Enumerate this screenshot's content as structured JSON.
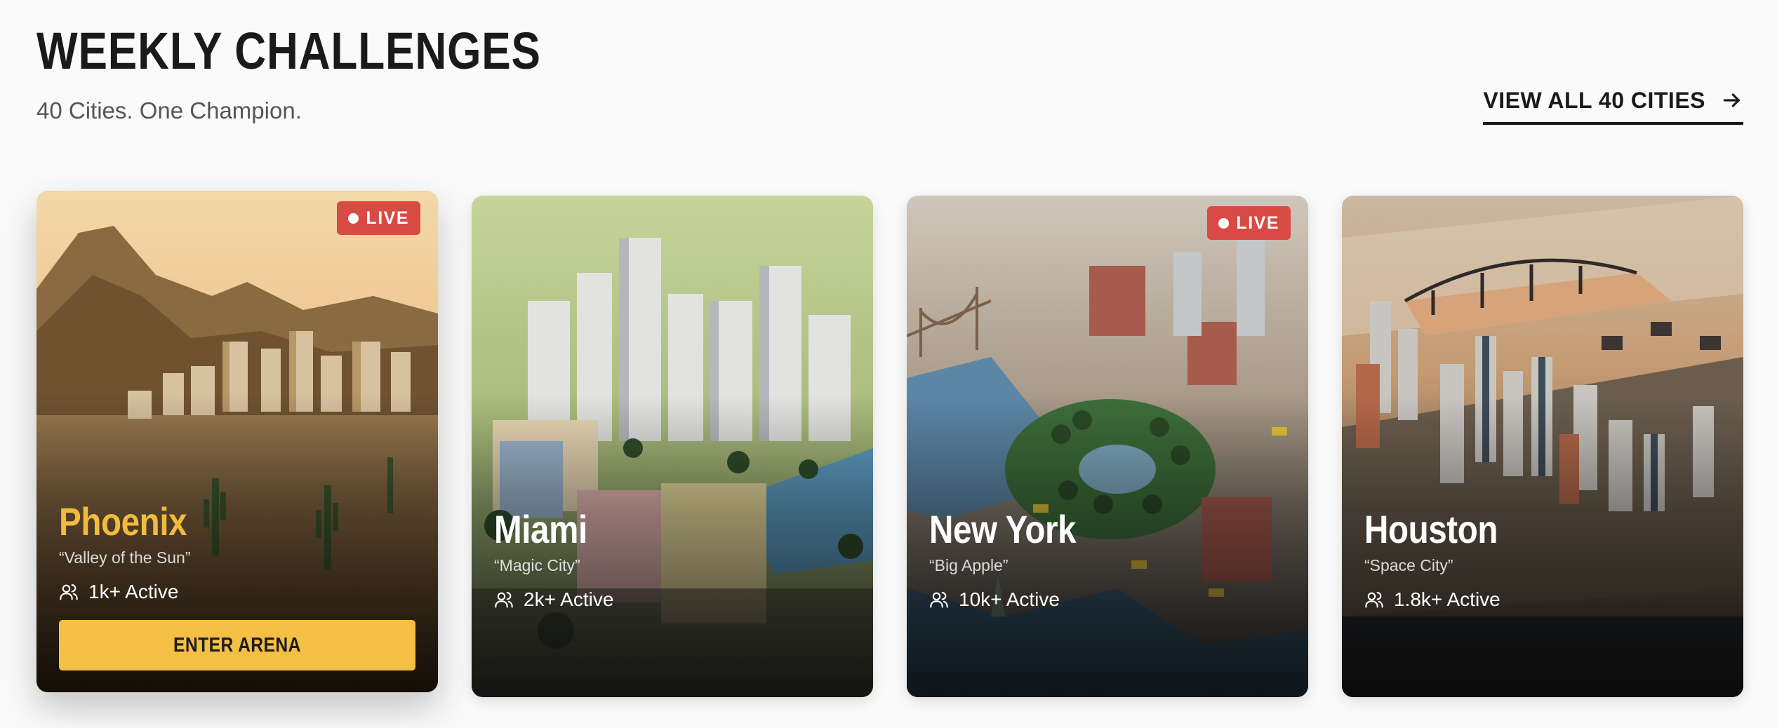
{
  "header": {
    "title": "WEEKLY CHALLENGES",
    "subtitle": "40 Cities. One Champion.",
    "view_all_label": "VIEW ALL 40 CITIES",
    "view_all_icon": "arrow-right-icon"
  },
  "cards": [
    {
      "city": "Phoenix",
      "nickname": "“Valley of the Sun”",
      "active": "1k+ Active",
      "live": true,
      "live_label": "LIVE",
      "cta": "ENTER ARENA",
      "icon": "users-icon"
    },
    {
      "city": "Miami",
      "nickname": "“Magic City”",
      "active": "2k+ Active",
      "live": false,
      "icon": "users-icon"
    },
    {
      "city": "New York",
      "nickname": "“Big Apple”",
      "active": "10k+ Active",
      "live": true,
      "live_label": "LIVE",
      "icon": "users-icon"
    },
    {
      "city": "Houston",
      "nickname": "“Space City”",
      "active": "1.8k+ Active",
      "live": false,
      "icon": "users-icon"
    }
  ],
  "colors": {
    "accent": "#f4bf45",
    "live_badge": "#d84a44",
    "text_dark": "#1a1a1a",
    "background": "#fafafa"
  }
}
